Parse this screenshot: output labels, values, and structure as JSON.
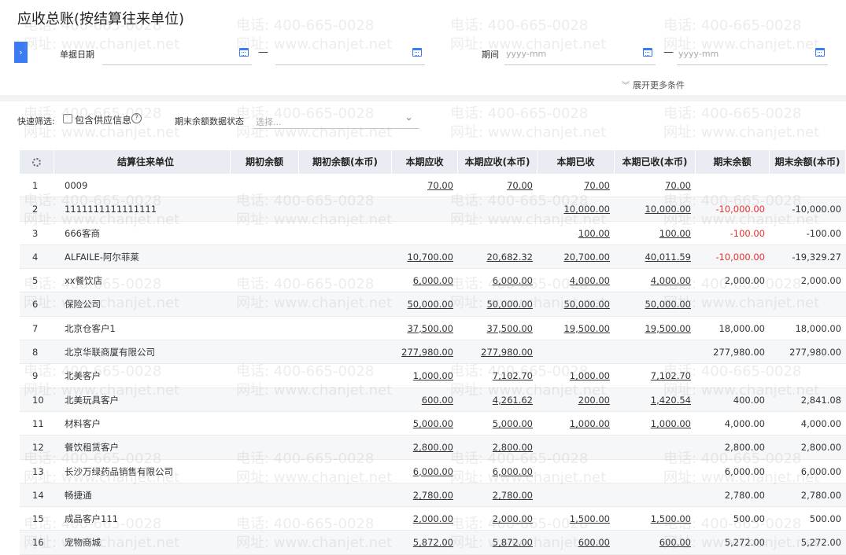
{
  "page": {
    "title": "应收总账(按结算往来单位)"
  },
  "filters": {
    "doc_date_label": "单据日期",
    "doc_date_from": "",
    "doc_date_to": "",
    "period_label": "期间",
    "period_from_placeholder": "yyyy-mm",
    "period_to_placeholder": "yyyy-mm",
    "range_dash": "—",
    "expand_label": "展开更多条件",
    "expand_icon": "chevron-double-down-icon",
    "side_toggle_icon": "chevron-right-icon"
  },
  "quick_filter": {
    "label": "快速筛选:",
    "include_supplier_label": "包含供应信息",
    "include_supplier_checked": false,
    "help_symbol": "?",
    "end_balance_status_label": "期末余额数据状态",
    "end_balance_status_placeholder": "选择..."
  },
  "table": {
    "columns": [
      "",
      "结算往来单位",
      "期初余额",
      "期初余额(本币)",
      "本期应收",
      "本期应收(本币)",
      "本期已收",
      "本期已收(本币)",
      "期末余额",
      "期末余额(本币)"
    ],
    "rows": [
      {
        "idx": "1",
        "name": "0009",
        "open": "",
        "open_lc": "",
        "recv": "70.00",
        "recv_lc": "70.00",
        "paid": "70.00",
        "paid_lc": "70.00",
        "end": "",
        "end_lc": "",
        "end_neg": false
      },
      {
        "idx": "2",
        "name": "1111111111111111",
        "open": "",
        "open_lc": "",
        "recv": "",
        "recv_lc": "",
        "paid": "10,000.00",
        "paid_lc": "10,000.00",
        "end": "-10,000.00",
        "end_lc": "-10,000.00",
        "end_neg": true
      },
      {
        "idx": "3",
        "name": "666客商",
        "open": "",
        "open_lc": "",
        "recv": "",
        "recv_lc": "",
        "paid": "100.00",
        "paid_lc": "100.00",
        "end": "-100.00",
        "end_lc": "-100.00",
        "end_neg": true
      },
      {
        "idx": "4",
        "name": "ALFAILE-阿尔菲莱",
        "open": "",
        "open_lc": "",
        "recv": "10,700.00",
        "recv_lc": "20,682.32",
        "paid": "20,700.00",
        "paid_lc": "40,011.59",
        "end": "-10,000.00",
        "end_lc": "-19,329.27",
        "end_neg": true
      },
      {
        "idx": "5",
        "name": "xx餐饮店",
        "open": "",
        "open_lc": "",
        "recv": "6,000.00",
        "recv_lc": "6,000.00",
        "paid": "4,000.00",
        "paid_lc": "4,000.00",
        "end": "2,000.00",
        "end_lc": "2,000.00",
        "end_neg": false
      },
      {
        "idx": "6",
        "name": "保险公司",
        "open": "",
        "open_lc": "",
        "recv": "50,000.00",
        "recv_lc": "50,000.00",
        "paid": "50,000.00",
        "paid_lc": "50,000.00",
        "end": "",
        "end_lc": "",
        "end_neg": false
      },
      {
        "idx": "7",
        "name": "北京仓客户1",
        "open": "",
        "open_lc": "",
        "recv": "37,500.00",
        "recv_lc": "37,500.00",
        "paid": "19,500.00",
        "paid_lc": "19,500.00",
        "end": "18,000.00",
        "end_lc": "18,000.00",
        "end_neg": false
      },
      {
        "idx": "8",
        "name": "北京华联商厦有限公司",
        "open": "",
        "open_lc": "",
        "recv": "277,980.00",
        "recv_lc": "277,980.00",
        "paid": "",
        "paid_lc": "",
        "end": "277,980.00",
        "end_lc": "277,980.00",
        "end_neg": false
      },
      {
        "idx": "9",
        "name": "北美客户",
        "open": "",
        "open_lc": "",
        "recv": "1,000.00",
        "recv_lc": "7,102.70",
        "paid": "1,000.00",
        "paid_lc": "7,102.70",
        "end": "",
        "end_lc": "",
        "end_neg": false
      },
      {
        "idx": "10",
        "name": "北美玩具客户",
        "open": "",
        "open_lc": "",
        "recv": "600.00",
        "recv_lc": "4,261.62",
        "paid": "200.00",
        "paid_lc": "1,420.54",
        "end": "400.00",
        "end_lc": "2,841.08",
        "end_neg": false
      },
      {
        "idx": "11",
        "name": "材料客户",
        "open": "",
        "open_lc": "",
        "recv": "5,000.00",
        "recv_lc": "5,000.00",
        "paid": "1,000.00",
        "paid_lc": "1,000.00",
        "end": "4,000.00",
        "end_lc": "4,000.00",
        "end_neg": false
      },
      {
        "idx": "12",
        "name": "餐饮租赁客户",
        "open": "",
        "open_lc": "",
        "recv": "2,800.00",
        "recv_lc": "2,800.00",
        "paid": "",
        "paid_lc": "",
        "end": "2,800.00",
        "end_lc": "2,800.00",
        "end_neg": false
      },
      {
        "idx": "13",
        "name": "长沙万绿药品销售有限公司",
        "open": "",
        "open_lc": "",
        "recv": "6,000.00",
        "recv_lc": "6,000.00",
        "paid": "",
        "paid_lc": "",
        "end": "6,000.00",
        "end_lc": "6,000.00",
        "end_neg": false
      },
      {
        "idx": "14",
        "name": "畅捷通",
        "open": "",
        "open_lc": "",
        "recv": "2,780.00",
        "recv_lc": "2,780.00",
        "paid": "",
        "paid_lc": "",
        "end": "2,780.00",
        "end_lc": "2,780.00",
        "end_neg": false
      },
      {
        "idx": "15",
        "name": "成品客户111",
        "open": "",
        "open_lc": "",
        "recv": "2,000.00",
        "recv_lc": "2,000.00",
        "paid": "1,500.00",
        "paid_lc": "1,500.00",
        "end": "500.00",
        "end_lc": "500.00",
        "end_neg": false
      },
      {
        "idx": "16",
        "name": "宠物商城",
        "open": "",
        "open_lc": "",
        "recv": "5,872.00",
        "recv_lc": "5,872.00",
        "paid": "600.00",
        "paid_lc": "600.00",
        "end": "5,272.00",
        "end_lc": "5,272.00",
        "end_neg": false
      }
    ]
  },
  "watermark": {
    "phone": "电话: 400-665-0028",
    "site": "网址: www.chanjet.net"
  },
  "colors": {
    "accent": "#3b7cf5",
    "negative": "#e8312f",
    "header_bg": "#e9ecf2",
    "alt_row": "#f6f7f9"
  }
}
